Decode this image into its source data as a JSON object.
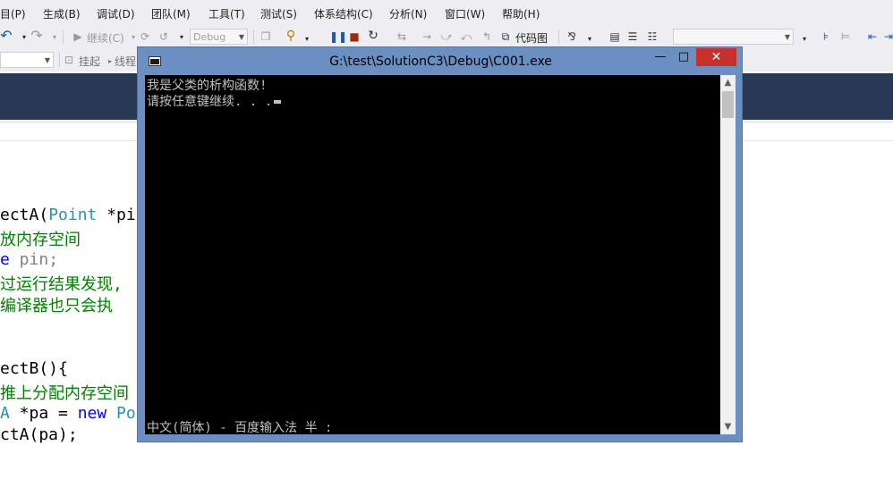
{
  "menu": {
    "items": [
      "目(P)",
      "生成(B)",
      "调试(D)",
      "团队(M)",
      "工具(T)",
      "测试(S)",
      "体系结构(C)",
      "分析(N)",
      "窗口(W)",
      "帮助(H)"
    ]
  },
  "toolbar": {
    "continue_label": "继续(C)",
    "config_value": "Debug",
    "code_map_label": "代码图",
    "suspend_label": "挂起",
    "thread_label": "线程"
  },
  "code": {
    "lines": [
      [
        {
          "t": "ectA(",
          "c": "plain"
        },
        {
          "t": "Point",
          "c": "type"
        },
        {
          "t": " *pi",
          "c": "plain"
        }
      ],
      [
        {
          "t": "放内存空间",
          "c": "cmt"
        }
      ],
      [
        {
          "t": "e",
          "c": "kw"
        },
        {
          "t": " pin;",
          "c": "param"
        }
      ],
      [
        {
          "t": "过运行结果发现,",
          "c": "cmt"
        }
      ],
      [
        {
          "t": "编译器也只会执",
          "c": "cmt"
        }
      ],
      [
        {
          "t": "",
          "c": "plain"
        }
      ],
      [
        {
          "t": "",
          "c": "plain"
        }
      ],
      [
        {
          "t": "ectB(){",
          "c": "plain"
        }
      ],
      [
        {
          "t": "推上分配内存空间",
          "c": "cmt"
        }
      ],
      [
        {
          "t": "A",
          "c": "type"
        },
        {
          "t": " *pa = ",
          "c": "plain"
        },
        {
          "t": "new",
          "c": "kw"
        },
        {
          "t": " Po",
          "c": "type"
        }
      ],
      [
        {
          "t": "ctA(pa);",
          "c": "plain"
        }
      ]
    ]
  },
  "console": {
    "title": "G:\\test\\SolutionC3\\Debug\\C001.exe",
    "output_line1": "我是父类的析构函数!",
    "output_line2": "请按任意键继续. . .",
    "ime_status": "中文(简体) - 百度输入法 半 :",
    "minimize_glyph": "—",
    "maximize_glyph": "□",
    "close_glyph": "✕"
  },
  "colors": {
    "console_frame": "#6b8fc1",
    "close_button": "#c7302b",
    "ide_nav_band": "#293955"
  }
}
